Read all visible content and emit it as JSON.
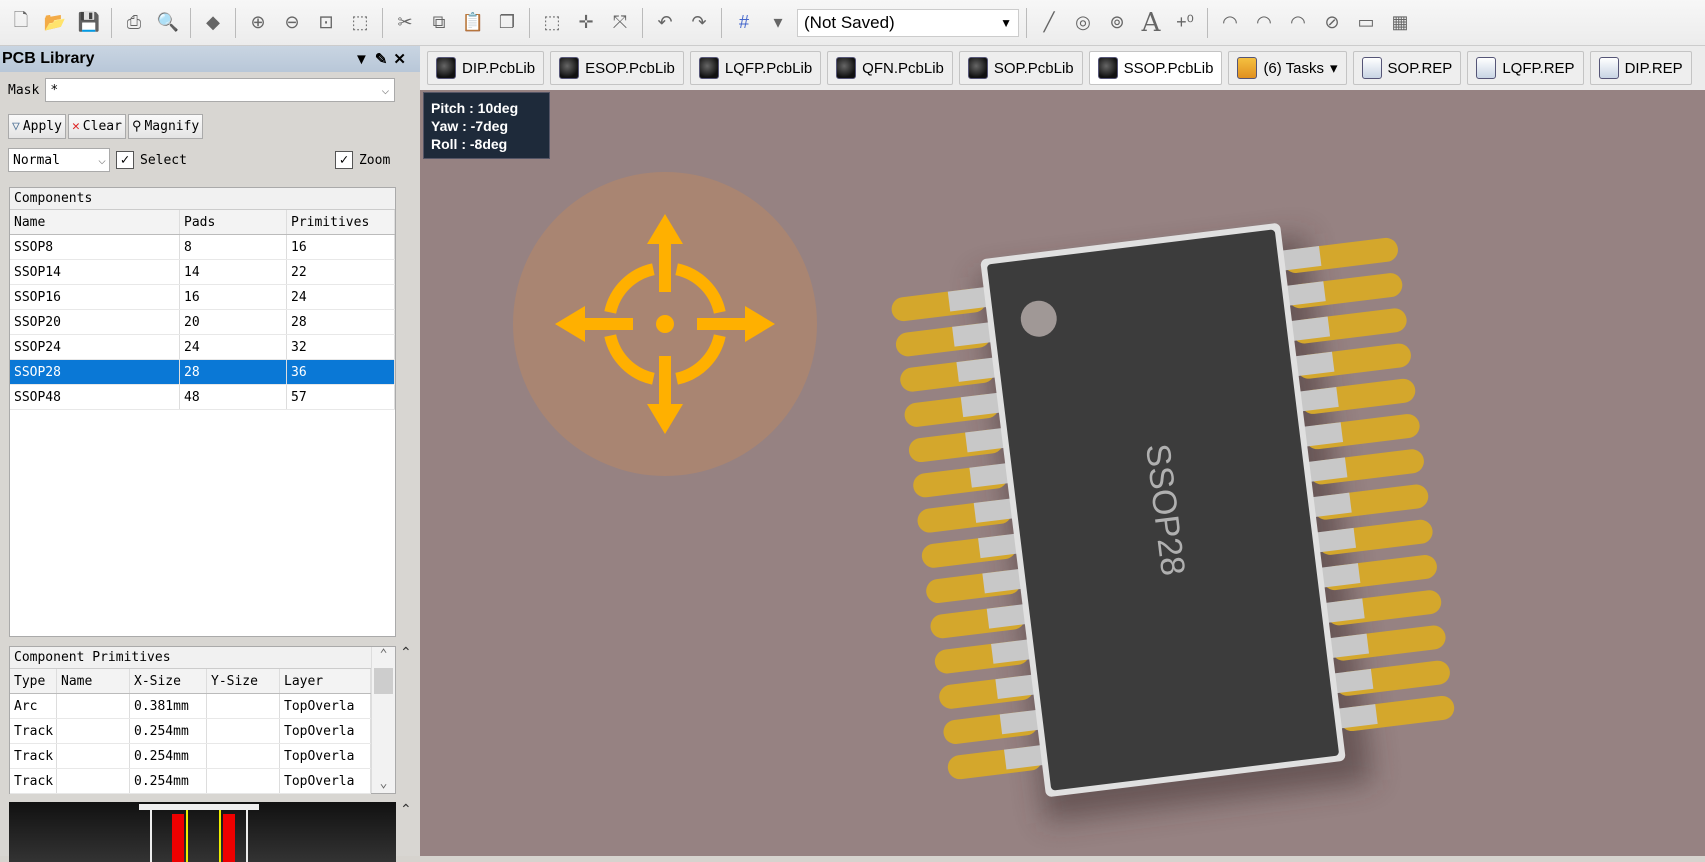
{
  "toolbar": {
    "icons": [
      "new-icon",
      "open-icon",
      "save-icon",
      "print-icon",
      "print-preview-icon",
      "3d-layer-icon",
      "zoom-in-icon",
      "zoom-out-icon",
      "zoom-fit-icon",
      "zoom-select-icon",
      "cut-icon",
      "copy-icon",
      "paste-icon",
      "rubber-stamp-icon",
      "select-rect-icon",
      "move-icon",
      "deselect-icon",
      "undo-icon",
      "redo-icon",
      "grid-icon"
    ],
    "view_config": "(Not Saved)"
  },
  "panel": {
    "title": "PCB Library",
    "mask_label": "Mask",
    "mask_value": "*",
    "apply": "Apply",
    "clear": "Clear",
    "magnify": "Magnify",
    "mode": "Normal",
    "select": "Select",
    "zoom": "Zoom",
    "select_checked": true,
    "zoom_checked": true
  },
  "components": {
    "title": "Components",
    "columns": [
      "Name",
      "Pads",
      "Primitives"
    ],
    "rows": [
      [
        "SSOP8",
        "8",
        "16"
      ],
      [
        "SSOP14",
        "14",
        "22"
      ],
      [
        "SSOP16",
        "16",
        "24"
      ],
      [
        "SSOP20",
        "20",
        "28"
      ],
      [
        "SSOP24",
        "24",
        "32"
      ],
      [
        "SSOP28",
        "28",
        "36"
      ],
      [
        "SSOP48",
        "48",
        "57"
      ]
    ],
    "selected": "SSOP28"
  },
  "primitives": {
    "title": "Component Primitives",
    "columns": [
      "Type",
      "Name",
      "X-Size",
      "Y-Size",
      "Layer"
    ],
    "rows": [
      [
        "Arc",
        "",
        "0.381mm",
        "",
        "TopOverla"
      ],
      [
        "Track",
        "",
        "0.254mm",
        "",
        "TopOverla"
      ],
      [
        "Track",
        "",
        "0.254mm",
        "",
        "TopOverla"
      ],
      [
        "Track",
        "",
        "0.254mm",
        "",
        "TopOverla"
      ]
    ]
  },
  "tabs": [
    {
      "label": "DIP.PcbLib",
      "icon": "pcb-lib-icon"
    },
    {
      "label": "ESOP.PcbLib",
      "icon": "pcb-lib-icon"
    },
    {
      "label": "LQFP.PcbLib",
      "icon": "pcb-lib-icon"
    },
    {
      "label": "QFN.PcbLib",
      "icon": "pcb-lib-icon"
    },
    {
      "label": "SOP.PcbLib",
      "icon": "pcb-lib-icon"
    },
    {
      "label": "SSOP.PcbLib",
      "icon": "pcb-lib-icon",
      "active": true
    },
    {
      "label": "(6) Tasks",
      "icon": "tasks-icon"
    },
    {
      "label": "SOP.REP",
      "icon": "document-icon"
    },
    {
      "label": "LQFP.REP",
      "icon": "document-icon"
    },
    {
      "label": "DIP.REP",
      "icon": "document-icon"
    }
  ],
  "view": {
    "pitch": "Pitch : 10deg",
    "yaw": "Yaw : -7deg",
    "roll": "Roll : -8deg",
    "chip_label": "SSOP28",
    "colors": {
      "board": "#968282",
      "body": "#3c3c3c",
      "pad": "#d4a72c",
      "lead": "#c8c8c8",
      "compass": "#ffb000"
    }
  }
}
